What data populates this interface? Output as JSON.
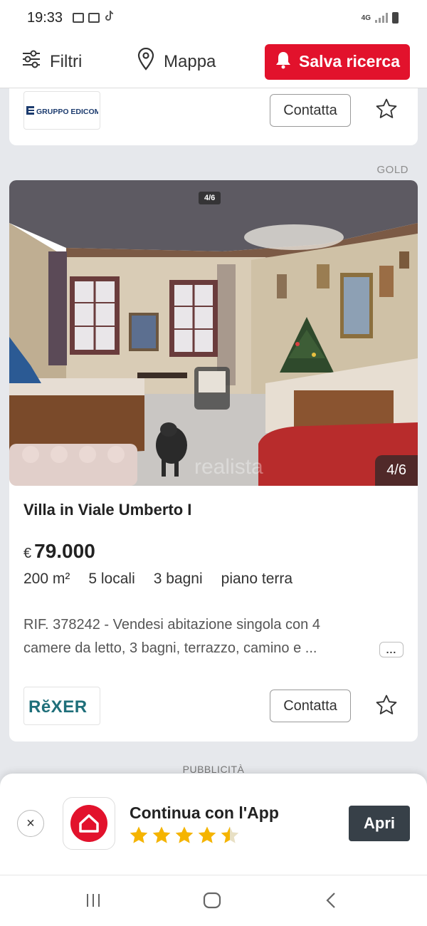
{
  "status_bar": {
    "time": "19:33",
    "network": "4G",
    "icons": [
      "gallery-icon",
      "calendar-icon",
      "tiktok-icon"
    ]
  },
  "toolbar": {
    "filters_label": "Filtri",
    "map_label": "Mappa",
    "save_search_label": "Salva ricerca"
  },
  "colors": {
    "accent_red": "#e2122c",
    "star_gold": "#f5b400",
    "dark_button": "#374048"
  },
  "prev_card": {
    "agency_logo_text": "GRUPPO EDICOM",
    "contact_label": "Contatta"
  },
  "listing": {
    "tier_label": "GOLD",
    "photo_counter_top": "4/6",
    "photo_counter": "4/6",
    "watermark": "realista",
    "title": "Villa in Viale Umberto I",
    "currency": "€",
    "price": "79.000",
    "area": "200 m²",
    "rooms": "5 locali",
    "baths": "3 bagni",
    "floor": "piano terra",
    "description": "RIF. 378242 - Vendesi abitazione singola con 4 camere da letto, 3 bagni, terrazzo, camino e ...",
    "more_label": "...",
    "agency_logo_text": "RĕXER",
    "contact_label": "Contatta"
  },
  "ad_label": "PUBBLICITÀ",
  "app_banner": {
    "close_label": "×",
    "title": "Continua con l'App",
    "rating": 4.5,
    "open_label": "Apri"
  }
}
